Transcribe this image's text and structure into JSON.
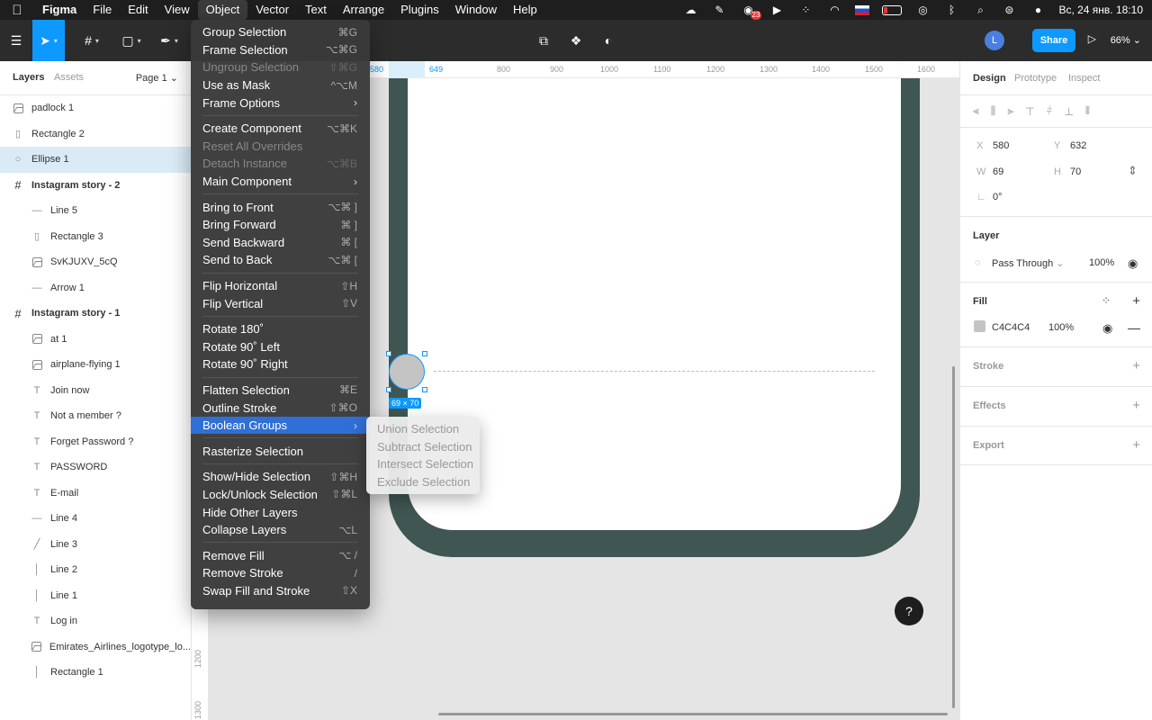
{
  "menubar": {
    "app": "Figma",
    "menus": [
      "File",
      "Edit",
      "View",
      "Object",
      "Vector",
      "Text",
      "Arrange",
      "Plugins",
      "Window",
      "Help"
    ],
    "active_menu": "Object",
    "notification_count": "23",
    "datetime": "Вс, 24 янв.  18:10"
  },
  "toolbar": {
    "user_initial": "L",
    "share_label": "Share",
    "zoom": "66%"
  },
  "layers_panel": {
    "tab_layers": "Layers",
    "tab_assets": "Assets",
    "page": "Page 1",
    "items": [
      {
        "name": "padlock 1",
        "icon": "image-icon",
        "level": 0
      },
      {
        "name": "Rectangle 2",
        "icon": "rectangle-icon",
        "level": 0
      },
      {
        "name": "Ellipse 1",
        "icon": "ellipse-icon",
        "level": 0,
        "selected": true
      },
      {
        "name": "Instagram story - 2",
        "icon": "frame-icon",
        "level": 0,
        "frame": true
      },
      {
        "name": "Line 5",
        "icon": "line-icon",
        "level": 1
      },
      {
        "name": "Rectangle 3",
        "icon": "rectangle-icon",
        "level": 1
      },
      {
        "name": "SvKJUXV_5cQ",
        "icon": "image-icon",
        "level": 1
      },
      {
        "name": "Arrow 1",
        "icon": "line-icon",
        "level": 1
      },
      {
        "name": "Instagram story - 1",
        "icon": "frame-icon",
        "level": 0,
        "frame": true
      },
      {
        "name": "at 1",
        "icon": "image-icon",
        "level": 1
      },
      {
        "name": "airplane-flying 1",
        "icon": "image-icon",
        "level": 1
      },
      {
        "name": "Join now",
        "icon": "text-icon",
        "level": 1
      },
      {
        "name": "Not a member ?",
        "icon": "text-icon",
        "level": 1
      },
      {
        "name": "Forget Password ?",
        "icon": "text-icon",
        "level": 1
      },
      {
        "name": "PASSWORD",
        "icon": "text-icon",
        "level": 1
      },
      {
        "name": "E-mail",
        "icon": "text-icon",
        "level": 1
      },
      {
        "name": "Line 4",
        "icon": "line-icon",
        "level": 1
      },
      {
        "name": "Line 3",
        "icon": "diagonal-line-icon",
        "level": 1
      },
      {
        "name": "Line 2",
        "icon": "vertical-line-icon",
        "level": 1
      },
      {
        "name": "Line 1",
        "icon": "vertical-line-icon",
        "level": 1
      },
      {
        "name": "Log in",
        "icon": "text-icon",
        "level": 1
      },
      {
        "name": "Emirates_Airlines_logotype_lo...",
        "icon": "image-icon",
        "level": 1
      },
      {
        "name": "Rectangle 1",
        "icon": "vertical-line-icon",
        "level": 1
      }
    ]
  },
  "ruler": {
    "top_ticks": [
      "580",
      "649",
      "800",
      "900",
      "1000",
      "1100",
      "1200",
      "1300",
      "1400",
      "1500",
      "1600"
    ],
    "left_ticks": [
      "1200",
      "1300"
    ]
  },
  "canvas": {
    "selection_size": "69 × 70"
  },
  "design_panel": {
    "tabs": [
      "Design",
      "Prototype",
      "Inspect"
    ],
    "x_label": "X",
    "x": "580",
    "y_label": "Y",
    "y": "632",
    "w_label": "W",
    "w": "69",
    "h_label": "H",
    "h": "70",
    "rotation": "0°",
    "layer_title": "Layer",
    "blend_mode": "Pass Through",
    "layer_opacity": "100%",
    "fill_title": "Fill",
    "fill_hex": "C4C4C4",
    "fill_opacity": "100%",
    "fill_color": "#c4c4c4",
    "stroke_title": "Stroke",
    "effects_title": "Effects",
    "export_title": "Export"
  },
  "object_menu": {
    "groups": [
      [
        {
          "label": "Group Selection",
          "shortcut": "⌘G"
        },
        {
          "label": "Frame Selection",
          "shortcut": "⌥⌘G"
        },
        {
          "label": "Ungroup Selection",
          "shortcut": "⇧⌘G",
          "disabled": true
        },
        {
          "label": "Use as Mask",
          "shortcut": "^⌥M"
        },
        {
          "label": "Frame Options",
          "submenu": true
        }
      ],
      [
        {
          "label": "Create Component",
          "shortcut": "⌥⌘K"
        },
        {
          "label": "Reset All Overrides",
          "disabled": true
        },
        {
          "label": "Detach Instance",
          "shortcut": "⌥⌘B",
          "disabled": true
        },
        {
          "label": "Main Component",
          "submenu": true
        }
      ],
      [
        {
          "label": "Bring to Front",
          "shortcut": "⌥⌘ ]"
        },
        {
          "label": "Bring Forward",
          "shortcut": "⌘ ]"
        },
        {
          "label": "Send Backward",
          "shortcut": "⌘ ["
        },
        {
          "label": "Send to Back",
          "shortcut": "⌥⌘ ["
        }
      ],
      [
        {
          "label": "Flip Horizontal",
          "shortcut": "⇧H"
        },
        {
          "label": "Flip Vertical",
          "shortcut": "⇧V"
        }
      ],
      [
        {
          "label": "Rotate 180˚"
        },
        {
          "label": "Rotate 90˚ Left"
        },
        {
          "label": "Rotate 90˚ Right"
        }
      ],
      [
        {
          "label": "Flatten Selection",
          "shortcut": "⌘E"
        },
        {
          "label": "Outline Stroke",
          "shortcut": "⇧⌘O"
        },
        {
          "label": "Boolean Groups",
          "submenu": true,
          "highlight": true
        }
      ],
      [
        {
          "label": "Rasterize Selection"
        }
      ],
      [
        {
          "label": "Show/Hide Selection",
          "shortcut": "⇧⌘H"
        },
        {
          "label": "Lock/Unlock Selection",
          "shortcut": "⇧⌘L"
        },
        {
          "label": "Hide Other Layers"
        },
        {
          "label": "Collapse Layers",
          "shortcut": "⌥L"
        }
      ],
      [
        {
          "label": "Remove Fill",
          "shortcut": "⌥ /"
        },
        {
          "label": "Remove Stroke",
          "shortcut": "/"
        },
        {
          "label": "Swap Fill and Stroke",
          "shortcut": "⇧X"
        }
      ]
    ]
  },
  "boolean_submenu": {
    "items": [
      "Union Selection",
      "Subtract Selection",
      "Intersect Selection",
      "Exclude Selection"
    ]
  },
  "help_label": "?"
}
